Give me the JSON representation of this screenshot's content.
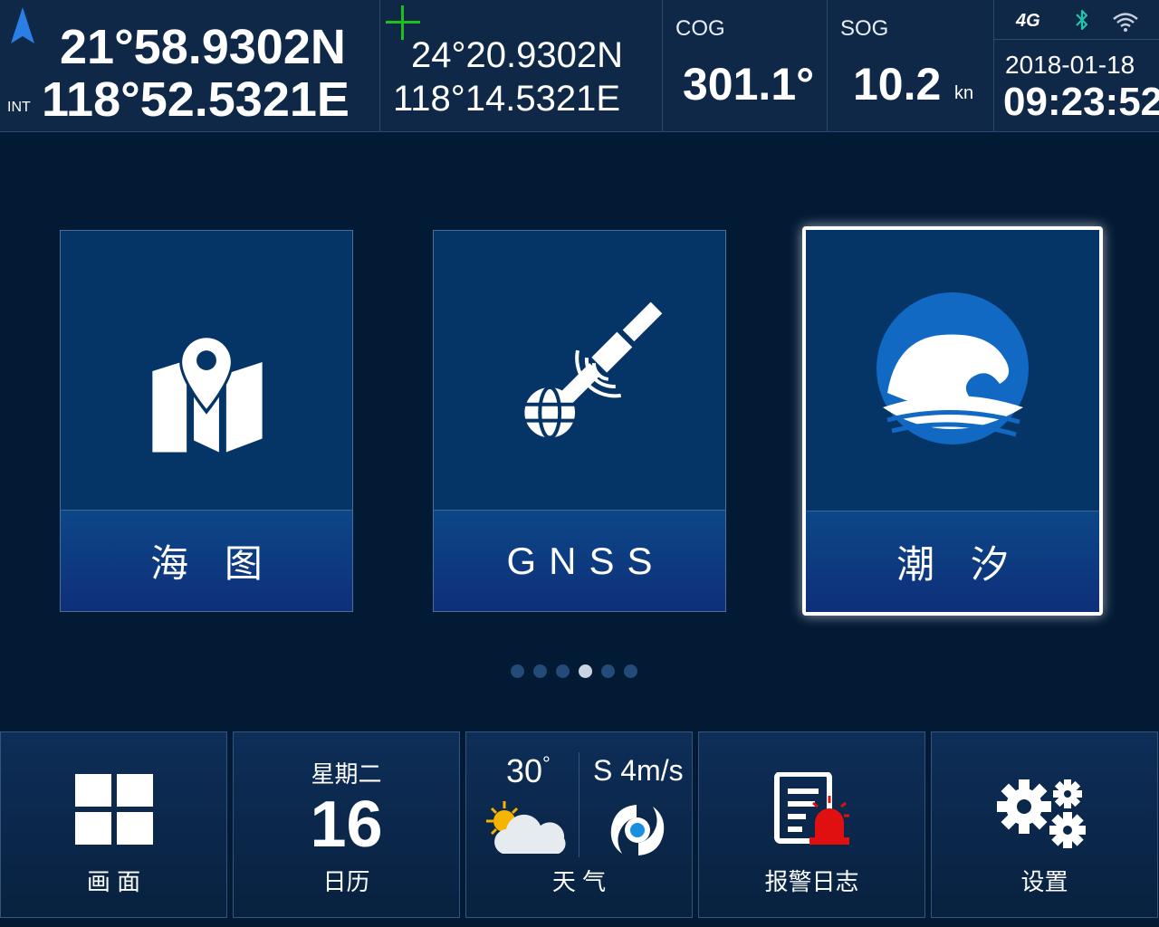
{
  "top": {
    "position": {
      "lat": "21°58.9302N",
      "lon": "118°52.5321E",
      "mode_label": "INT"
    },
    "cursor": {
      "lat": "24°20.9302N",
      "lon": "118°14.5321E"
    },
    "cog": {
      "label": "COG",
      "value": "301.1°"
    },
    "sog": {
      "label": "SOG",
      "value": "10.2",
      "unit": "kn"
    },
    "status": {
      "network": "4G",
      "date": "2018-01-18",
      "time": "09:23:52"
    }
  },
  "cards": [
    {
      "label": "海 图",
      "icon": "chart-map-icon"
    },
    {
      "label": "GNSS",
      "icon": "satellite-icon"
    },
    {
      "label": "潮 汐",
      "icon": "tide-wave-icon",
      "selected": true
    }
  ],
  "pager": {
    "count": 6,
    "active_index": 3
  },
  "tiles": {
    "screen": {
      "label": "画 面"
    },
    "calendar": {
      "weekday": "星期二",
      "day": "16",
      "label": "日历"
    },
    "weather": {
      "temp": "30",
      "temp_unit": "°",
      "wind": "S 4m/s",
      "label": "天 气"
    },
    "alarm_log": {
      "label": "报警日志"
    },
    "settings": {
      "label": "设置"
    }
  },
  "colors": {
    "accent": "#0b5bb0",
    "background": "#031a34",
    "cursor": "#1ec01e",
    "alarm": "#e01010"
  }
}
